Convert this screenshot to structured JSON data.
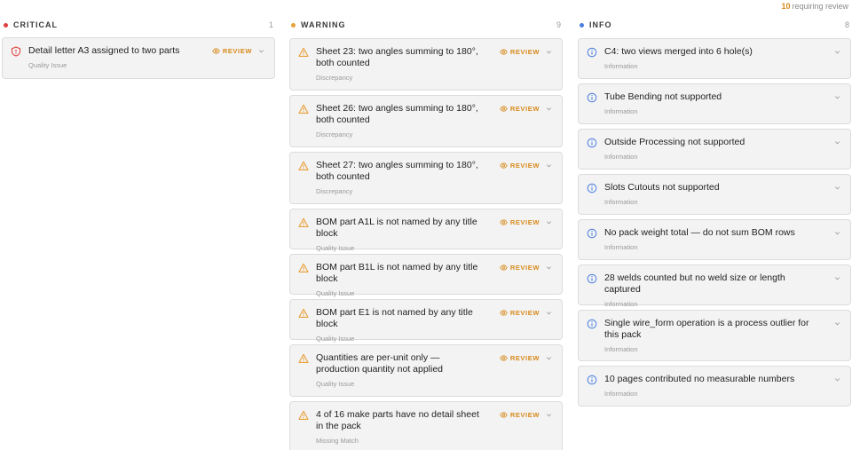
{
  "summary": {
    "count": "10",
    "text": "requiring review"
  },
  "colors": {
    "critical": "#e04040",
    "warning": "#e8a03a",
    "info": "#4a7fe0"
  },
  "review_label": "REVIEW",
  "columns": {
    "critical": {
      "title": "CRITICAL",
      "count": "1",
      "items": [
        {
          "title": "Detail letter A3 assigned to two parts",
          "category": "Quality Issue",
          "icon": "shield-alert-icon"
        }
      ]
    },
    "warning": {
      "title": "WARNING",
      "count": "9",
      "items": [
        {
          "title": "Sheet 23: two angles summing to 180°, both counted",
          "category": "Discrepancy",
          "icon": "warning-triangle-icon"
        },
        {
          "title": "Sheet 26: two angles summing to 180°, both counted",
          "category": "Discrepancy",
          "icon": "warning-triangle-icon"
        },
        {
          "title": "Sheet 27: two angles summing to 180°, both counted",
          "category": "Discrepancy",
          "icon": "warning-triangle-icon"
        },
        {
          "title": "BOM part A1L is not named by any title block",
          "category": "Quality Issue",
          "icon": "warning-triangle-icon"
        },
        {
          "title": "BOM part B1L is not named by any title block",
          "category": "Quality Issue",
          "icon": "warning-triangle-icon"
        },
        {
          "title": "BOM part E1 is not named by any title block",
          "category": "Quality Issue",
          "icon": "warning-triangle-icon"
        },
        {
          "title": "Quantities are per-unit only — production quantity not applied",
          "category": "Quality Issue",
          "icon": "warning-triangle-icon"
        },
        {
          "title": "4 of 16 make parts have no detail sheet in the pack",
          "category": "Missing Match",
          "icon": "warning-triangle-icon"
        }
      ]
    },
    "info": {
      "title": "INFO",
      "count": "8",
      "items": [
        {
          "title": "C4: two views merged into 6 hole(s)",
          "category": "Information",
          "icon": "info-circle-icon"
        },
        {
          "title": "Tube Bending not supported",
          "category": "Information",
          "icon": "info-circle-icon"
        },
        {
          "title": "Outside Processing not supported",
          "category": "Information",
          "icon": "info-circle-icon"
        },
        {
          "title": "Slots Cutouts not supported",
          "category": "Information",
          "icon": "info-circle-icon"
        },
        {
          "title": "No pack weight total — do not sum BOM rows",
          "category": "Information",
          "icon": "info-circle-icon"
        },
        {
          "title": "28 welds counted but no weld size or length captured",
          "category": "Information",
          "icon": "info-circle-icon"
        },
        {
          "title": "Single wire_form operation is a process outlier for this pack",
          "category": "Information",
          "icon": "info-circle-icon"
        },
        {
          "title": "10 pages contributed no measurable numbers",
          "category": "Information",
          "icon": "info-circle-icon"
        }
      ]
    }
  }
}
